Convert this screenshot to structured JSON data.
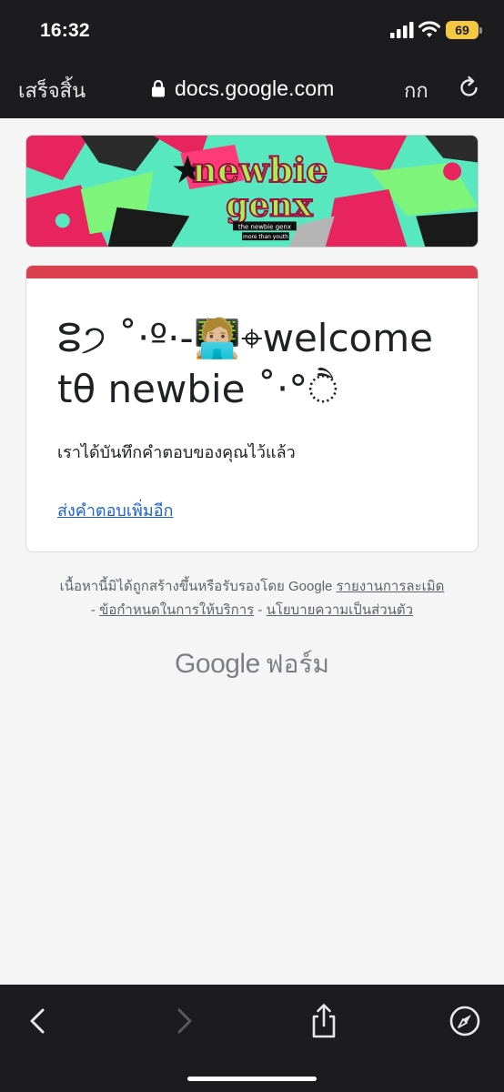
{
  "status_bar": {
    "time": "16:32",
    "battery_level": "69"
  },
  "browser": {
    "done_label": "เสร็จสิ้น",
    "url": "docs.google.com",
    "text_size_label": "กก"
  },
  "banner": {
    "title_line1": "newbie",
    "title_line2": "genx",
    "subtitle": "the newbie genx",
    "tagline": "more than youth"
  },
  "form_card": {
    "title": "ⵓ੭‎ ˚‧º·-🧑🏼‍💻⌖welcome tθ newbie ˚‧°ੈ",
    "message": "เราได้บันทึกคำตอบของคุณไว้แล้ว",
    "submit_another": "ส่งคำตอบเพิ่มอีก",
    "accent_color": "#db4050"
  },
  "footer": {
    "disclaimer": "เนื้อหานี้มิได้ถูกสร้างขึ้นหรือรับรองโดย Google",
    "report_abuse": "รายงานการละเมิด",
    "terms": "ข้อกำหนดในการให้บริการ",
    "privacy": "นโยบายความเป็นส่วนตัว",
    "separator": " - "
  },
  "branding": {
    "google": "Google",
    "forms": "ฟอร์ม"
  },
  "toolbar": {
    "back_icon": "chevron-left-icon",
    "forward_icon": "chevron-right-icon",
    "share_icon": "share-icon",
    "browser_icon": "compass-icon"
  }
}
